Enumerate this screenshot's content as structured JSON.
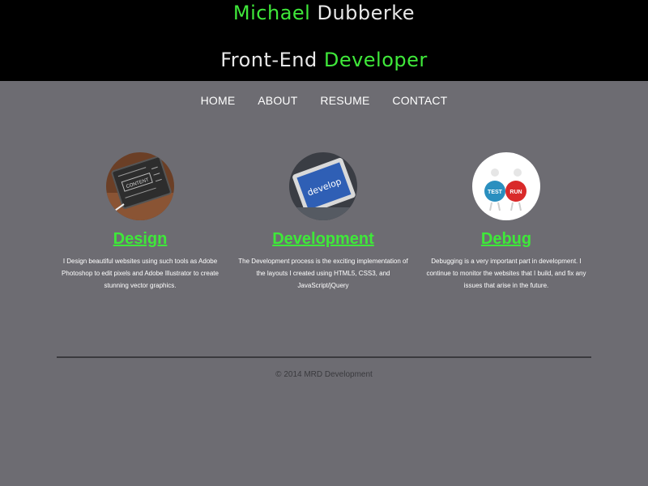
{
  "header": {
    "name_first": "Michael",
    "name_last": " Dubberke",
    "role_first": "Front-End",
    "role_second": " Developer"
  },
  "nav": {
    "items": [
      {
        "label": "HOME"
      },
      {
        "label": "ABOUT"
      },
      {
        "label": "RESUME"
      },
      {
        "label": "CONTACT"
      }
    ]
  },
  "features": [
    {
      "title": "Design",
      "description": "I Design beautiful websites using such tools as Adobe Photoshop to edit pixels and Adobe Illustrator to create stunning vector graphics.",
      "image_label": "CONTENT"
    },
    {
      "title": "Development",
      "description": "The Development process is the exciting implementation of the layouts I created using HTML5, CSS3, and JavaScript/jQuery",
      "image_label": "develop"
    },
    {
      "title": "Debug",
      "description": "Debugging is a very important part in development. I continue to monitor the websites that I build, and fix any issues that arise in the future.",
      "image_label_left": "TEST",
      "image_label_right": "RUN"
    }
  ],
  "footer": {
    "text": "© 2014 MRD Development"
  },
  "colors": {
    "accent": "#3fe83a",
    "background": "#6d6c72",
    "header_bg": "#000000"
  }
}
